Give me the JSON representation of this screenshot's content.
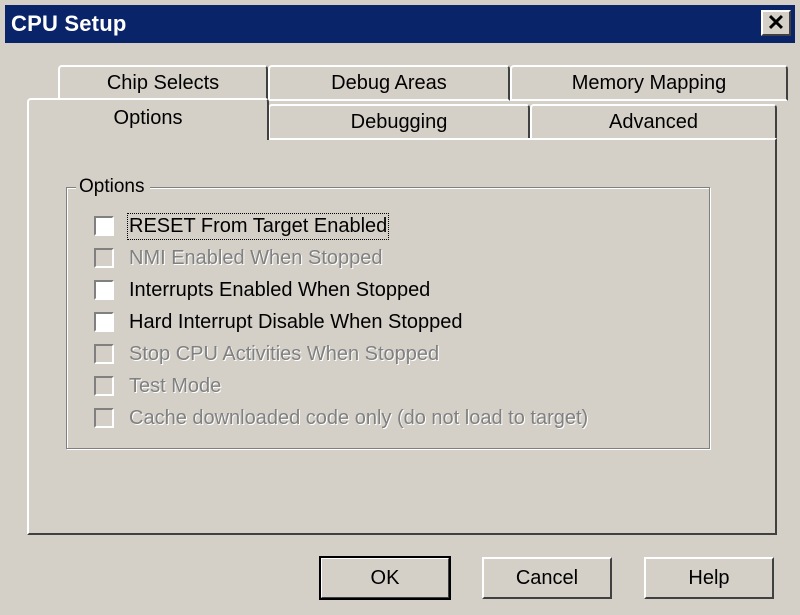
{
  "window": {
    "title": "CPU Setup",
    "close_glyph": "✕"
  },
  "tabs": {
    "back_row": [
      {
        "label": "Chip Selects"
      },
      {
        "label": "Debug Areas"
      },
      {
        "label": "Memory Mapping"
      }
    ],
    "front_row": [
      {
        "label": "Options",
        "active": true
      },
      {
        "label": "Debugging"
      },
      {
        "label": "Advanced"
      }
    ]
  },
  "group": {
    "title": "Options",
    "items": [
      {
        "label": "RESET From Target Enabled",
        "checked": false,
        "enabled": true,
        "focused": true
      },
      {
        "label": "NMI Enabled When Stopped",
        "checked": false,
        "enabled": false
      },
      {
        "label": "Interrupts Enabled When Stopped",
        "checked": false,
        "enabled": true
      },
      {
        "label": "Hard Interrupt Disable When Stopped",
        "checked": false,
        "enabled": true
      },
      {
        "label": "Stop CPU Activities When Stopped",
        "checked": false,
        "enabled": false
      },
      {
        "label": "Test Mode",
        "checked": false,
        "enabled": false
      },
      {
        "label": "Cache downloaded code only (do not load to target)",
        "checked": false,
        "enabled": false
      }
    ]
  },
  "buttons": {
    "ok": "OK",
    "cancel": "Cancel",
    "help": "Help"
  },
  "colors": {
    "title_bar": "#0a246a",
    "face": "#d4d0c8",
    "disabled_text": "#808080"
  }
}
